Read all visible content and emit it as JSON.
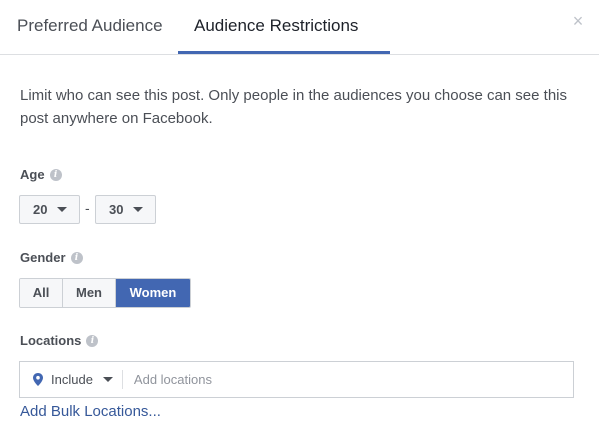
{
  "tabs": [
    {
      "label": "Preferred Audience",
      "active": false
    },
    {
      "label": "Audience Restrictions",
      "active": true
    }
  ],
  "close_icon": "×",
  "description": "Limit who can see this post. Only people in the audiences you choose can see this post anywhere on Facebook.",
  "age": {
    "label": "Age",
    "min": "20",
    "separator": "-",
    "max": "30"
  },
  "gender": {
    "label": "Gender",
    "options": [
      "All",
      "Men",
      "Women"
    ],
    "selected": "Women"
  },
  "locations": {
    "label": "Locations",
    "mode": "Include",
    "placeholder": "Add locations",
    "bulk_link": "Add Bulk Locations..."
  },
  "info_glyph": "i",
  "colors": {
    "accent": "#4267b2",
    "link": "#365899"
  }
}
